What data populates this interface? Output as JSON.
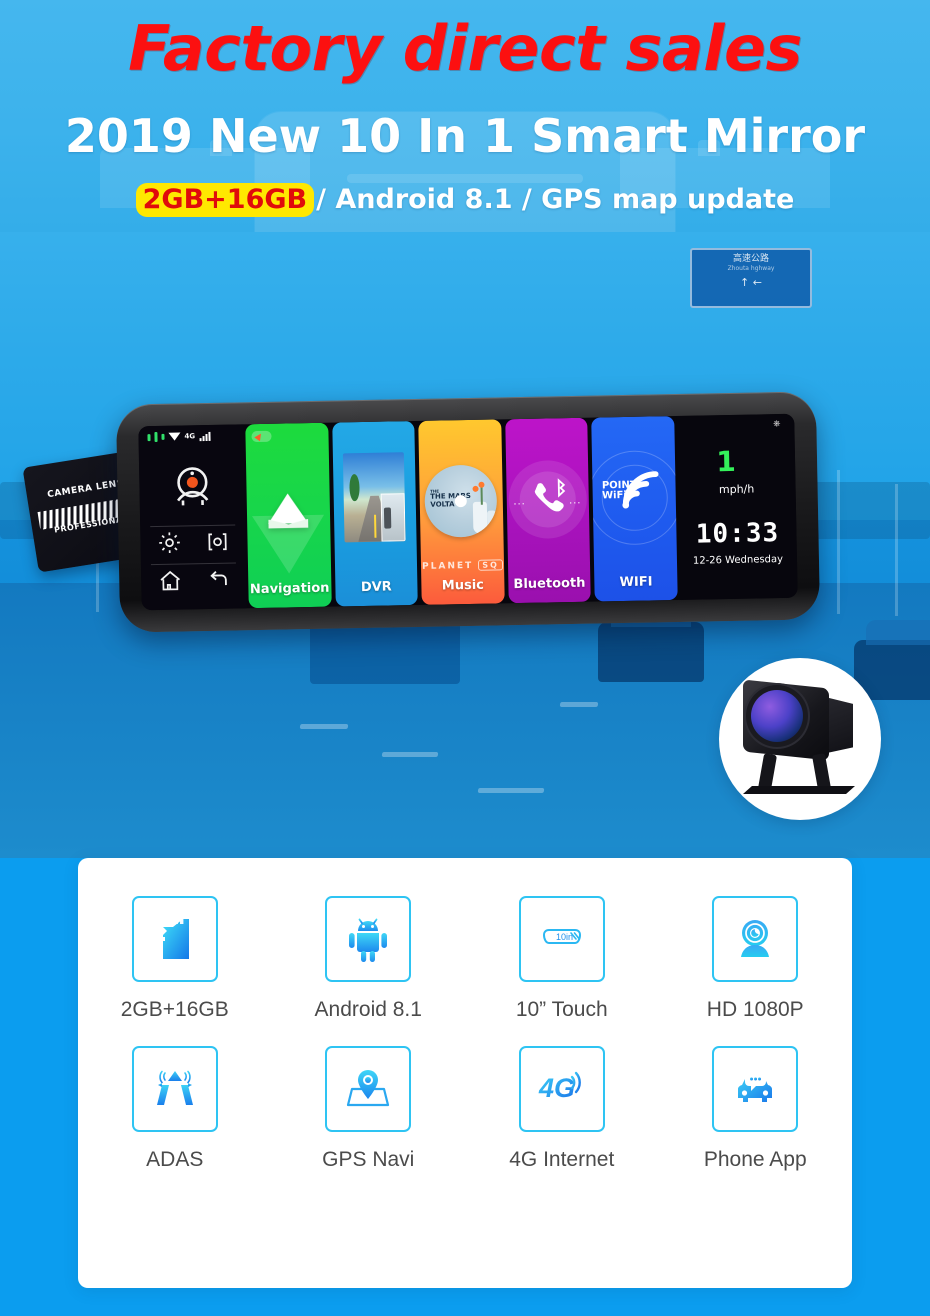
{
  "header": {
    "headline": "Factory direct sales",
    "title": "2019 New 10 In 1 Smart Mirror",
    "spec_highlight": "2GB+16GB",
    "spec_rest": "/ Android 8.1 / GPS map update",
    "headline_color": "#fc1010",
    "highlight_bg": "#ffe800",
    "header_bg": "#3cb2ec"
  },
  "device": {
    "status": {
      "network": "4G",
      "signal_icon": "signal-bars-icon",
      "wifi_icon": "wifi-icon"
    },
    "controls": [
      {
        "name": "camera-icon",
        "label": "Camera"
      },
      {
        "name": "settings-gear-icon",
        "label": "Settings"
      },
      {
        "name": "target-record-icon",
        "label": "Record"
      },
      {
        "name": "home-icon",
        "label": "Home"
      },
      {
        "name": "back-arrow-icon",
        "label": "Back"
      }
    ],
    "tiles": [
      {
        "label": "Navigation",
        "color": "#18d64a",
        "icon": "navigation-arrow-icon"
      },
      {
        "label": "DVR",
        "color": "#1a9ee0",
        "icon": "dashcam-photo-icon"
      },
      {
        "label": "Music",
        "color": "#ff9a3c",
        "icon": "cd-album-icon",
        "album_artist": "THE MARS VOLTA",
        "album_title": "PLANET",
        "album_badge": "SQ"
      },
      {
        "label": "Bluetooth",
        "color": "#a912bd",
        "icon": "bluetooth-phone-icon"
      },
      {
        "label": "WIFI",
        "color": "#1f5bef",
        "icon": "wifi-point-icon",
        "icon_text": "POINT WiFi"
      }
    ],
    "info": {
      "speed": "1",
      "speed_unit": "mph/h",
      "clock": "10:33",
      "date": "12-26 Wednesday",
      "usb_icon": "usb-icon"
    }
  },
  "camera_tag": {
    "line1": "CAMERA LENS",
    "line2": "PROFESSIONAL",
    "icon": "arrows-icon"
  },
  "rear_camera": {
    "name": "rear-camera-badge"
  },
  "road_sign": {
    "line1": "高速公路",
    "line2": "Zhouta  hghway"
  },
  "features": [
    {
      "label": "2GB+16GB",
      "icon": "sd-card-icon"
    },
    {
      "label": "Android 8.1",
      "icon": "android-robot-icon"
    },
    {
      "label": "10” Touch",
      "icon": "mirror-screen-icon",
      "icon_text": "10in"
    },
    {
      "label": "HD 1080P",
      "icon": "webcam-icon"
    },
    {
      "label": "ADAS",
      "icon": "adas-lane-icon"
    },
    {
      "label": "GPS Navi",
      "icon": "map-pin-icon"
    },
    {
      "label": "4G Internet",
      "icon": "4g-signal-icon",
      "icon_text": "4G"
    },
    {
      "label": "Phone App",
      "icon": "car-chat-icon"
    }
  ]
}
